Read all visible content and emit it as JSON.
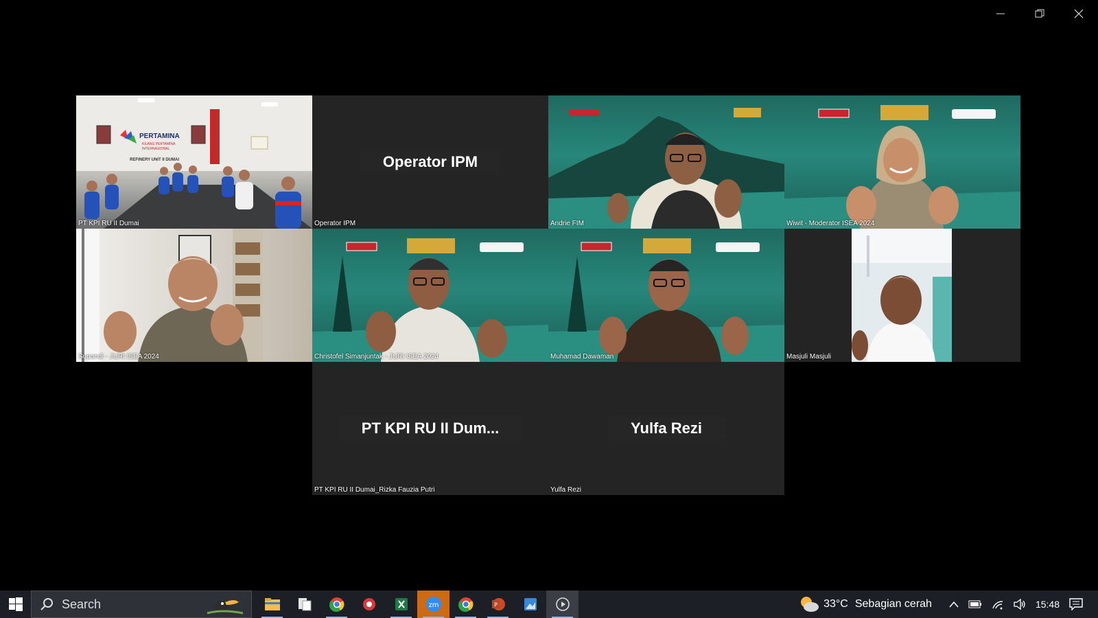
{
  "window": {
    "controls": [
      "minimize-icon",
      "restore-icon",
      "close-icon"
    ]
  },
  "gallery": {
    "tiles": [
      {
        "id": "pt-kpi",
        "label": "PT KPI RU II Dumai",
        "video": true
      },
      {
        "id": "operator",
        "label": "Operator IPM",
        "center_name": "Operator IPM",
        "video": false
      },
      {
        "id": "andrie",
        "label": "Andrie FIM",
        "video": true
      },
      {
        "id": "wiwit",
        "label": "Wiwit - Moderator ISEA 2024",
        "video": true
      },
      {
        "id": "supandi",
        "label": "Supandi - JURI ISEA 2024",
        "video": true
      },
      {
        "id": "christofel",
        "label": "Christofel Simanjuntak - JURI ISEA 2024",
        "video": true
      },
      {
        "id": "muhamad",
        "label": "Muhamad Dawaman",
        "video": true
      },
      {
        "id": "masjuli",
        "label": "Masjuli Masjuli",
        "video": true
      },
      {
        "id": "rizka",
        "label": "PT KPI RU II Dumai_Rizka Fauzia Putri",
        "center_name": "PT KPI RU II Dum...",
        "video": false
      },
      {
        "id": "yulfa",
        "label": "Yulfa Rezi",
        "center_name": "Yulfa Rezi",
        "video": false
      }
    ],
    "room_sign": {
      "brand": "PERTAMINA",
      "line1": "KILANG PERTAMINA",
      "line2": "INTERNASIONAL",
      "line3": "REFINERY UNIT II DUMAI"
    }
  },
  "taskbar": {
    "search_placeholder": "Search",
    "apps": [
      "file-explorer-icon",
      "files-icon",
      "chrome-icon",
      "app-red-icon",
      "excel-icon",
      "zoom-icon",
      "chrome-icon",
      "powerpoint-icon",
      "photos-icon",
      "media-player-icon"
    ],
    "weather": {
      "temp": "33°C",
      "condition": "Sebagian cerah"
    },
    "time": "15:48"
  },
  "colors": {
    "background": "#000000",
    "tile": "#242424",
    "taskbar": "#1c1f26",
    "zoom_accent": "#cc6b12"
  }
}
